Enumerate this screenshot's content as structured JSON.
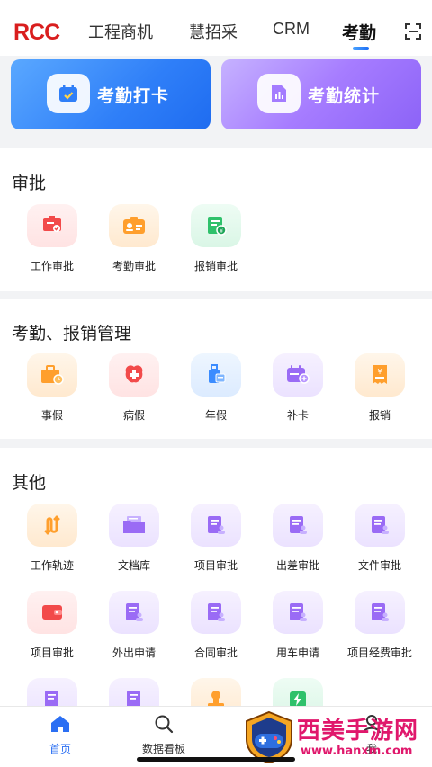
{
  "header": {
    "logo": "RCC",
    "tabs": [
      "工程商机",
      "慧招采",
      "CRM",
      "考勤"
    ],
    "active_tab": "考勤"
  },
  "banners": [
    {
      "label": "考勤打卡",
      "icon": "calendar-check-icon"
    },
    {
      "label": "考勤统计",
      "icon": "bar-chart-icon"
    }
  ],
  "sections": {
    "approval": {
      "title": "审批",
      "items": [
        {
          "label": "工作审批",
          "icon": "work-approval-icon",
          "color": "#f24a4a"
        },
        {
          "label": "考勤审批",
          "icon": "attendance-approval-icon",
          "color": "#ff9f2d"
        },
        {
          "label": "报销审批",
          "icon": "reimburse-approval-icon",
          "color": "#2fc16b"
        }
      ]
    },
    "attendance": {
      "title": "考勤、报销管理",
      "items": [
        {
          "label": "事假",
          "icon": "briefcase-clock-icon",
          "color": "#ff9f2d"
        },
        {
          "label": "病假",
          "icon": "medical-cross-icon",
          "color": "#f24a4a"
        },
        {
          "label": "年假",
          "icon": "luggage-icon",
          "color": "#3b8cff"
        },
        {
          "label": "补卡",
          "icon": "calendar-plus-icon",
          "color": "#9a6bf5"
        },
        {
          "label": "报销",
          "icon": "receipt-icon",
          "color": "#ff9f2d"
        }
      ]
    },
    "other": {
      "title": "其他",
      "rows": [
        [
          {
            "label": "工作轨迹",
            "icon": "track-icon",
            "color": "#ff9f2d"
          },
          {
            "label": "文档库",
            "icon": "folder-icon",
            "color": "#9a6bf5"
          },
          {
            "label": "项目审批",
            "icon": "document-user-icon",
            "color": "#9a6bf5"
          },
          {
            "label": "出差审批",
            "icon": "document-user-icon",
            "color": "#9a6bf5"
          },
          {
            "label": "文件审批",
            "icon": "document-user-icon",
            "color": "#9a6bf5"
          }
        ],
        [
          {
            "label": "项目审批",
            "icon": "wallet-icon",
            "color": "#f24a4a"
          },
          {
            "label": "外出申请",
            "icon": "document-user-icon",
            "color": "#9a6bf5"
          },
          {
            "label": "合同审批",
            "icon": "document-user-icon",
            "color": "#9a6bf5"
          },
          {
            "label": "用车申请",
            "icon": "document-user-icon",
            "color": "#9a6bf5"
          },
          {
            "label": "项目经费审批",
            "icon": "document-user-icon",
            "color": "#9a6bf5"
          }
        ],
        [
          {
            "label": "",
            "icon": "document-icon",
            "color": "#9a6bf5"
          },
          {
            "label": "",
            "icon": "document-icon",
            "color": "#9a6bf5"
          },
          {
            "label": "",
            "icon": "stamp-icon",
            "color": "#ff9f2d"
          },
          {
            "label": "",
            "icon": "lightning-icon",
            "color": "#2fc16b"
          }
        ]
      ]
    }
  },
  "bottom_nav": [
    {
      "label": "首页",
      "icon": "home-icon",
      "active": true
    },
    {
      "label": "数据看板",
      "icon": "search-icon",
      "active": false
    },
    {
      "label": "",
      "icon": "",
      "active": false
    },
    {
      "label": "我",
      "icon": "profile-icon",
      "active": false
    }
  ],
  "watermark": {
    "text": "西美手游网",
    "url": "www.hanxm.com"
  }
}
